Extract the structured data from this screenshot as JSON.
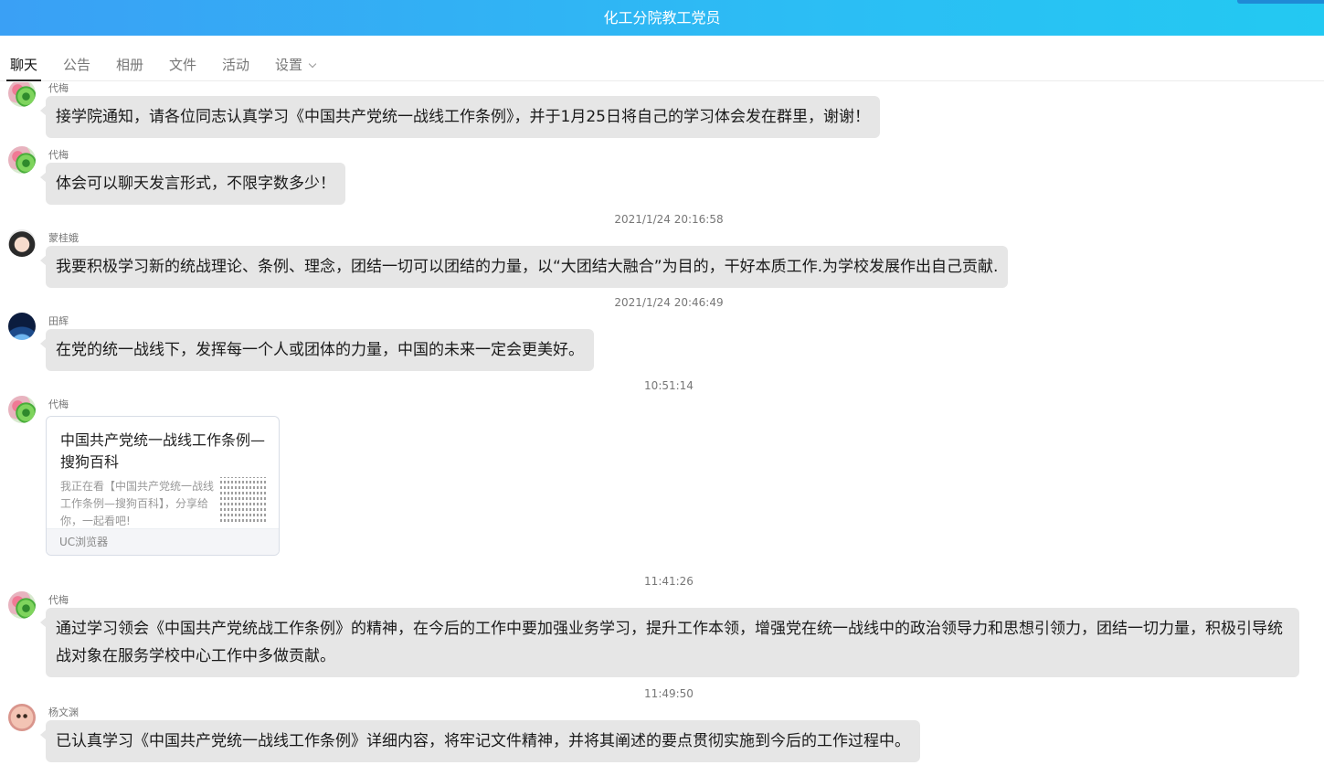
{
  "window": {
    "title": "化工分院教工党员"
  },
  "tabs": [
    {
      "label": "聊天"
    },
    {
      "label": "公告"
    },
    {
      "label": "相册"
    },
    {
      "label": "文件"
    },
    {
      "label": "活动"
    },
    {
      "label": "设置"
    }
  ],
  "messages": [
    {
      "sender": "代梅",
      "text": "接学院通知，请各位同志认真学习《中国共产党统一战线工作条例》，并于1月25日将自己的学习体会发在群里，谢谢！"
    },
    {
      "sender": "代梅",
      "text": "体会可以聊天发言形式，不限字数多少！"
    },
    {
      "timestamp": "2021/1/24 20:16:58"
    },
    {
      "sender": "蒙桂娥",
      "text": "我要积极学习新的统战理论、条例、理念，团结一切可以团结的力量，以“大团结大融合”为目的，干好本质工作.为学校发展作出自己贡献."
    },
    {
      "timestamp": "2021/1/24 20:46:49"
    },
    {
      "sender": "田辉",
      "text": "在党的统一战线下，发挥每一个人或团体的力量，中国的未来一定会更美好。"
    },
    {
      "timestamp": "10:51:14"
    },
    {
      "sender": "代梅",
      "card": {
        "title": "中国共产党统一战线工作条例—搜狗百科",
        "description": "我正在看【中国共产党统一战线工作条例—搜狗百科】，分享给你，一起看吧!",
        "source": "UC浏览器"
      }
    },
    {
      "timestamp": "11:41:26"
    },
    {
      "sender": "代梅",
      "text": "通过学习领会《中国共产党统战工作条例》的精神，在今后的工作中要加强业务学习，提升工作本领，增强党在统一战线中的政治领导力和思想引领力，团结一切力量，积极引导统战对象在服务学校中心工作中多做贡献。"
    },
    {
      "timestamp": "11:49:50"
    },
    {
      "sender": "杨文渊",
      "text": "已认真学习《中国共产党统一战线工作条例》详细内容，将牢记文件精神，并将其阐述的要点贯彻实施到今后的工作过程中。"
    }
  ]
}
